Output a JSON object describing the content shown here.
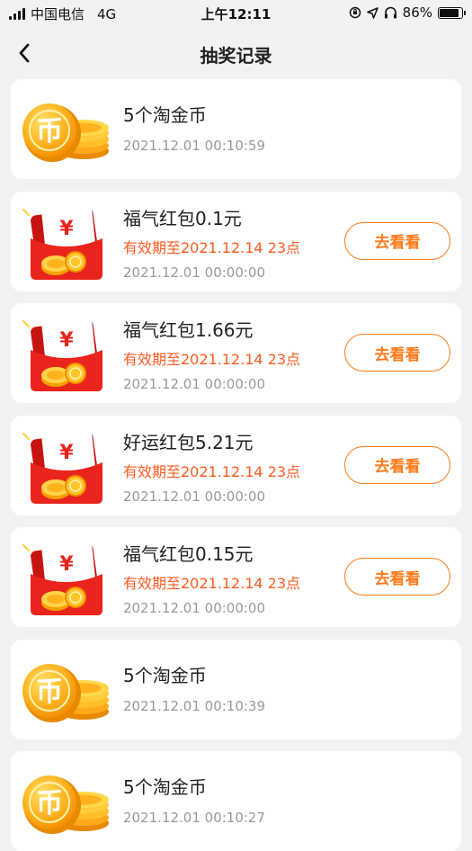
{
  "status_bar": {
    "carrier": "中国电信",
    "network": "4G",
    "time": "上午12:11",
    "battery": "86%",
    "battery_level": 0.86
  },
  "header": {
    "title": "抽奖记录"
  },
  "records": [
    {
      "type": "coin",
      "title": "5个淘金币",
      "time": "2021.12.01 00:10:59"
    },
    {
      "type": "redpacket",
      "title": "福气红包0.1元",
      "validity": "有效期至2021.12.14 23点",
      "time": "2021.12.01 00:00:00",
      "button": "去看看"
    },
    {
      "type": "redpacket",
      "title": "福气红包1.66元",
      "validity": "有效期至2021.12.14 23点",
      "time": "2021.12.01 00:00:00",
      "button": "去看看"
    },
    {
      "type": "redpacket",
      "title": "好运红包5.21元",
      "validity": "有效期至2021.12.14 23点",
      "time": "2021.12.01 00:00:00",
      "button": "去看看"
    },
    {
      "type": "redpacket",
      "title": "福气红包0.15元",
      "validity": "有效期至2021.12.14 23点",
      "time": "2021.12.01 00:00:00",
      "button": "去看看"
    },
    {
      "type": "coin",
      "title": "5个淘金币",
      "time": "2021.12.01 00:10:39"
    },
    {
      "type": "coin",
      "title": "5个淘金币",
      "time": "2021.12.01 00:10:27"
    }
  ],
  "icons": {
    "coin_icon": "taobao-coin-stack-icon",
    "red_packet_icon": "red-packet-icon",
    "back_icon": "chevron-left-icon"
  },
  "colors": {
    "accent": "#ff7a1a",
    "validity": "#ff5a1f",
    "coin": "#ffb21e",
    "red_packet": "#e8241c",
    "background": "#f2f2f2"
  }
}
